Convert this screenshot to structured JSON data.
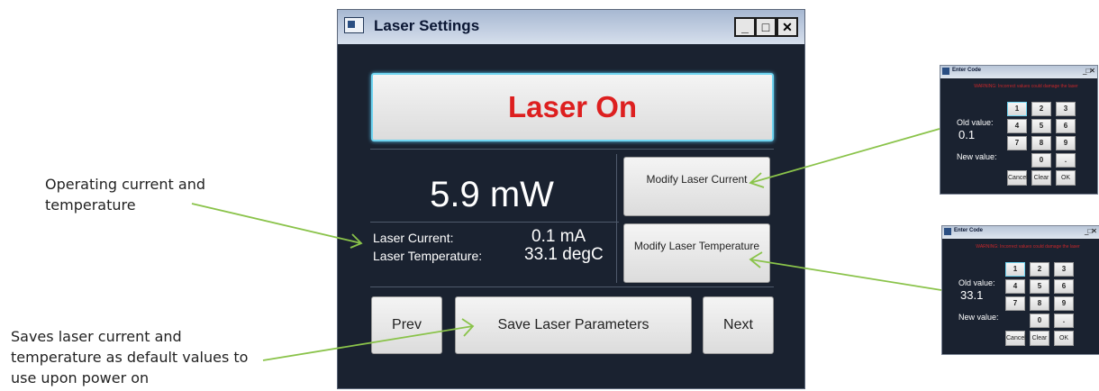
{
  "annotations": {
    "current": "Operating current and temperature",
    "save": "Saves laser current and temperature as default values to use upon power on"
  },
  "window": {
    "title": "Laser Settings",
    "minimize": "_",
    "maximize": "□",
    "close": "✕"
  },
  "laser_button": "Laser On",
  "power": "5.9 mW",
  "readings": {
    "current_label": "Laser Current:",
    "current_value": "0.1 mA",
    "temperature_label": "Laser Temperature:",
    "temperature_value": "33.1 degC"
  },
  "buttons": {
    "modify_current": "Modify Laser Current",
    "modify_temperature": "Modify Laser Temperature",
    "prev": "Prev",
    "save": "Save Laser Parameters",
    "next": "Next"
  },
  "dialogs": [
    {
      "title": "Enter Code",
      "warning": "WARNING: Incorrect values could damage the laser",
      "old_label": "Old value:",
      "old_value": "0.1",
      "new_label": "New value:",
      "keys": [
        "1",
        "2",
        "3",
        "4",
        "5",
        "6",
        "7",
        "8",
        "9",
        "0",
        "."
      ],
      "cancel": "Cancel",
      "clear": "Clear",
      "ok": "OK"
    },
    {
      "title": "Enter Code",
      "warning": "WARNING: Incorrect values could damage the laser",
      "old_label": "Old value:",
      "old_value": "33.1",
      "new_label": "New value:",
      "keys": [
        "1",
        "2",
        "3",
        "4",
        "5",
        "6",
        "7",
        "8",
        "9",
        "0",
        "."
      ],
      "cancel": "Cancel",
      "clear": "Clear",
      "ok": "OK"
    }
  ],
  "colors": {
    "background": "#1a2230",
    "laser_text": "#dd1f1f",
    "arrow": "#8ac34a"
  }
}
